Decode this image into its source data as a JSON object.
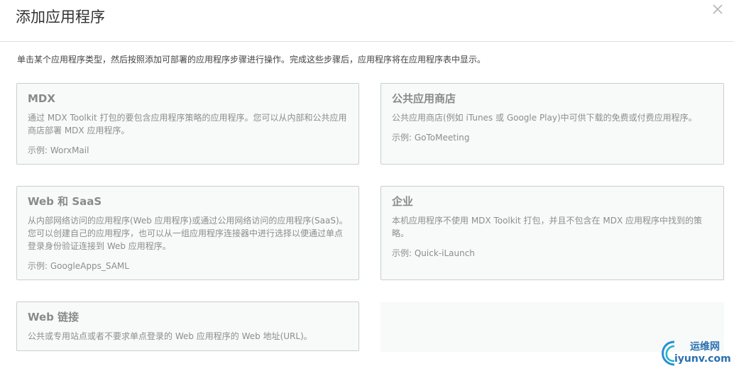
{
  "dialog": {
    "title": "添加应用程序",
    "instructions": "单击某个应用程序类型，然后按照添加可部署的应用程序步骤进行操作。完成这些步骤后，应用程序将在应用程序表中显示。"
  },
  "cards": {
    "mdx": {
      "title": "MDX",
      "desc": "通过 MDX Toolkit 打包的要包含应用程序策略的应用程序。您可以从内部和公共应用商店部署 MDX 应用程序。",
      "example": "示例: WorxMail"
    },
    "public_store": {
      "title": "公共应用商店",
      "desc": "公共应用商店(例如 iTunes 或 Google Play)中可供下载的免费或付费应用程序。",
      "example": "示例: GoToMeeting"
    },
    "web_saas": {
      "title": "Web 和 SaaS",
      "desc": "从内部网络访问的应用程序(Web 应用程序)或通过公用网络访问的应用程序(SaaS)。您可以创建自己的应用程序，也可以从一组应用程序连接器中进行选择以便通过单点登录身份验证连接到 Web 应用程序。",
      "example": "示例: GoogleApps_SAML"
    },
    "enterprise": {
      "title": "企业",
      "desc": "本机应用程序不使用 MDX Toolkit 打包，并且不包含在 MDX 应用程序中找到的策略。",
      "example": "示例: Quick-iLaunch"
    },
    "web_link": {
      "title": "Web 链接",
      "desc": "公共或专用站点或者不要求单点登录的 Web 应用程序的 Web 地址(URL)。"
    }
  },
  "watermark": {
    "line1": "运维网",
    "line2": "iyunv.com"
  },
  "colors": {
    "card_bg": "#f7faf9",
    "card_border": "#c9cfcd",
    "watermark": "#2a6fb0"
  }
}
